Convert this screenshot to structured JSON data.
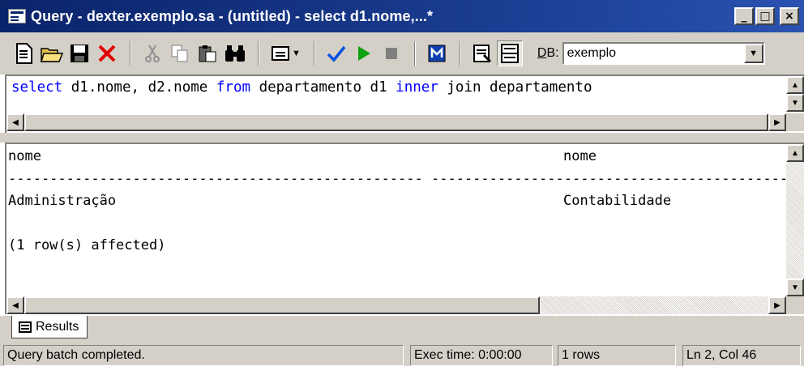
{
  "window": {
    "title": "Query - dexter.exemplo.sa - (untitled) - select d1.nome,...*",
    "minimize": "_",
    "maximize": "□",
    "close": "×"
  },
  "toolbar": {
    "db_label_prefix": "D",
    "db_label_rest": "B:",
    "db_value": "exemplo",
    "icons": [
      "new-query-icon",
      "open-folder-icon",
      "save-icon",
      "delete-icon",
      "cut-icon",
      "copy-icon",
      "paste-icon",
      "find-icon",
      "results-mode-icon",
      "parse-check-icon",
      "execute-icon",
      "stop-icon",
      "object-browser-icon",
      "properties-icon",
      "results-pane-icon"
    ]
  },
  "editor": {
    "tokens": [
      {
        "t": "select",
        "kw": true
      },
      {
        "t": " d1.nome, d2.nome ",
        "kw": false
      },
      {
        "t": "from",
        "kw": true
      },
      {
        "t": " departamento d1 ",
        "kw": false
      },
      {
        "t": "inner",
        "kw": true
      },
      {
        "t": " join departamento",
        "kw": false
      }
    ]
  },
  "results": {
    "columns": [
      "nome",
      "nome"
    ],
    "separator_1": "-------------------------------------------------- ",
    "separator_2": "--------------------------------------------------",
    "rows": [
      [
        "Administração",
        "Contabilidade"
      ]
    ],
    "affected": "(1 row(s) affected)"
  },
  "tabs": [
    {
      "label": "Results"
    }
  ],
  "status": {
    "message": "Query batch completed.",
    "exec_time": "Exec time: 0:00:00",
    "rows": "1 rows",
    "position": "Ln 2, Col 46"
  },
  "colors": {
    "title_bg": "#0a246a",
    "keyword": "#0000ff",
    "face": "#d4d0c8"
  }
}
